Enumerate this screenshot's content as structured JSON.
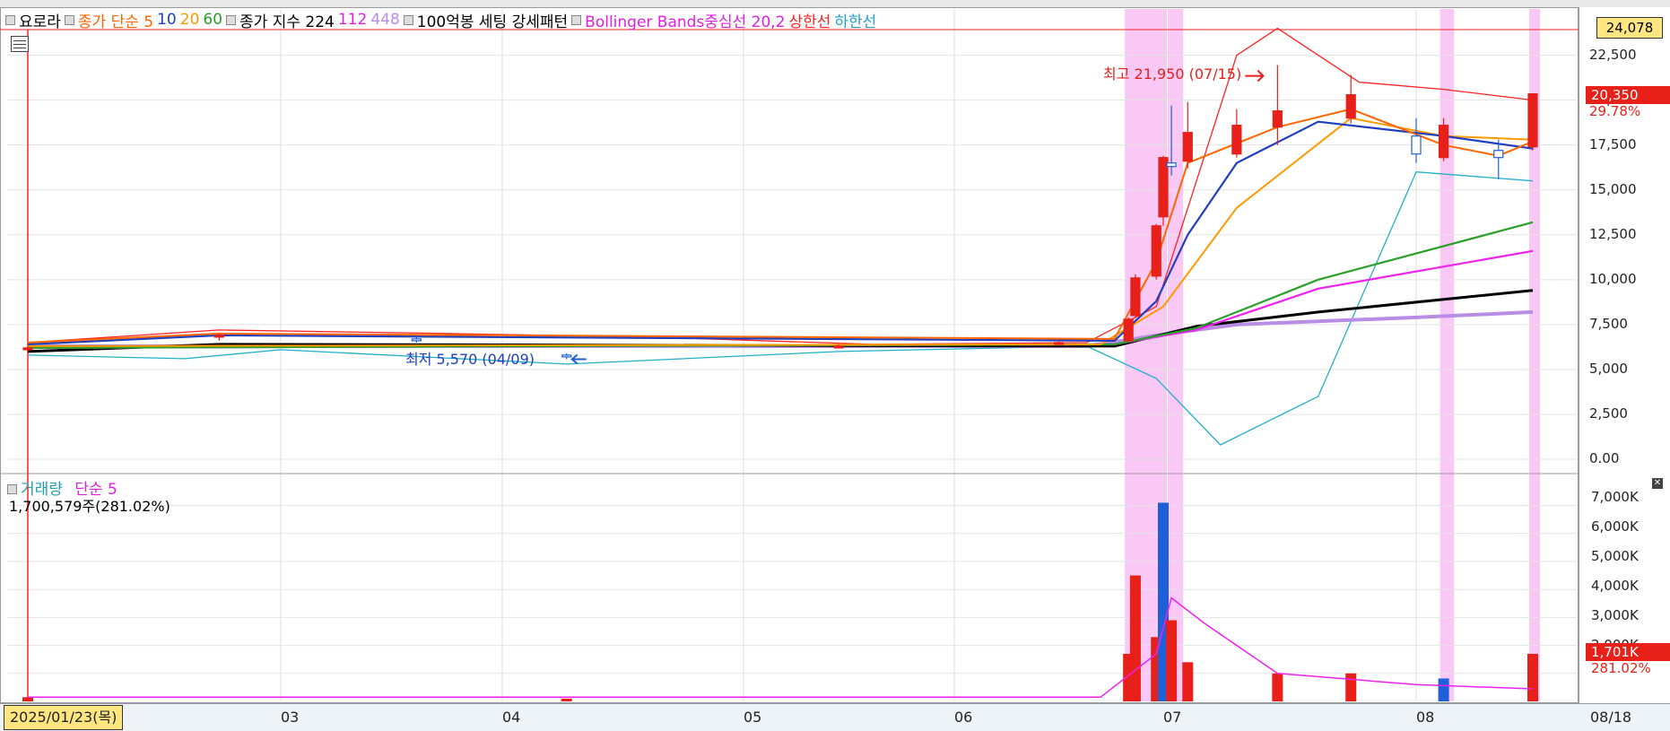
{
  "legend": {
    "items": [
      {
        "text": "요로라",
        "color": "#000000"
      },
      {
        "text": "종가 단순 5",
        "color": "#ff6600"
      },
      {
        "text": "10",
        "color": "#1f3fbf"
      },
      {
        "text": "20",
        "color": "#ff9900"
      },
      {
        "text": "60",
        "color": "#2aa02a"
      },
      {
        "text": "종가 지수 224",
        "color": "#000000"
      },
      {
        "text": "112",
        "color": "#dd22dd"
      },
      {
        "text": "448",
        "color": "#b98ce6"
      },
      {
        "text": "100억봉 세팅 강세패턴",
        "color": "#000000"
      },
      {
        "text": "Bollinger Bands중심선 20,2",
        "color": "#e020e0"
      },
      {
        "text": "상한선",
        "color": "#ff2222"
      },
      {
        "text": "하한선",
        "color": "#22a0d0"
      }
    ]
  },
  "annotations": {
    "high_label": "최고 21,950 (07/15)",
    "low_label": "최저 5,570 (04/09)",
    "volume_title": "거래량",
    "volume_ma": "단순 5",
    "volume_reading": "1,700,579주(281.02%)"
  },
  "price_axis": {
    "ticks": [
      "22,500",
      "20,000",
      "17,500",
      "15,000",
      "12,500",
      "10,000",
      "7,500",
      "5,000",
      "2,500",
      "0.00"
    ],
    "top_box": "24,078",
    "current_price": "20,350",
    "current_change": "29.78%"
  },
  "volume_axis": {
    "ticks": [
      "7,000K",
      "6,000K",
      "5,000K",
      "4,000K",
      "3,000K",
      "2,000K"
    ],
    "current_volume": "1,701K",
    "current_ratio": "281.02%"
  },
  "dates": {
    "current": "2025/01/23(목)",
    "months": [
      "03",
      "04",
      "05",
      "06",
      "07",
      "08",
      "08/18"
    ]
  },
  "colors": {
    "up": "#e8201a",
    "down": "#1f5fd8",
    "ma5": "#ff6600",
    "ma10": "#1f3fbf",
    "ma20": "#ff9900",
    "ma60": "#2aa02a",
    "ema224": "#000000",
    "ema112": "#ee22ee",
    "ema448": "#b98ce6",
    "bb_upper": "#ff2222",
    "bb_lower": "#22b0c8",
    "highlight": "#f7b6f0"
  },
  "chart_data": [
    {
      "type": "candlestick",
      "title": "요로라",
      "ylim": [
        0,
        24078
      ],
      "x_months": [
        "03",
        "04",
        "05",
        "06",
        "07",
        "08"
      ],
      "points": [
        {
          "date": "2025-01-23",
          "open": 6100,
          "high": 6300,
          "low": 6000,
          "close": 6200
        },
        {
          "date": "2025-02-20",
          "open": 6800,
          "high": 7000,
          "low": 6600,
          "close": 6900
        },
        {
          "date": "2025-03-20",
          "open": 6700,
          "high": 6900,
          "low": 6500,
          "close": 6600
        },
        {
          "date": "2025-04-09",
          "open": 5800,
          "high": 5900,
          "low": 5570,
          "close": 5700
        },
        {
          "date": "2025-05-15",
          "open": 6300,
          "high": 6400,
          "low": 6200,
          "close": 6300
        },
        {
          "date": "2025-06-16",
          "open": 6500,
          "high": 6600,
          "low": 6400,
          "close": 6500
        },
        {
          "date": "2025-06-26",
          "open": 6600,
          "high": 7900,
          "low": 6500,
          "close": 7800
        },
        {
          "date": "2025-06-27",
          "open": 8000,
          "high": 10300,
          "low": 7900,
          "close": 10100
        },
        {
          "date": "2025-06-30",
          "open": 10200,
          "high": 13100,
          "low": 10000,
          "close": 13000
        },
        {
          "date": "2025-07-01",
          "open": 13500,
          "high": 16900,
          "low": 13000,
          "close": 16800
        },
        {
          "date": "2025-07-02",
          "open": 16500,
          "high": 19700,
          "low": 15800,
          "close": 16300
        },
        {
          "date": "2025-07-04",
          "open": 16600,
          "high": 19900,
          "low": 16200,
          "close": 18200
        },
        {
          "date": "2025-07-10",
          "open": 17000,
          "high": 19500,
          "low": 16800,
          "close": 18600
        },
        {
          "date": "2025-07-15",
          "open": 18500,
          "high": 21950,
          "low": 17500,
          "close": 19400
        },
        {
          "date": "2025-07-24",
          "open": 19000,
          "high": 21400,
          "low": 18700,
          "close": 20300
        },
        {
          "date": "2025-08-01",
          "open": 18000,
          "high": 19000,
          "low": 16500,
          "close": 17000
        },
        {
          "date": "2025-08-05",
          "open": 16800,
          "high": 19000,
          "low": 16600,
          "close": 18600
        },
        {
          "date": "2025-08-13",
          "open": 17200,
          "high": 17800,
          "low": 15600,
          "close": 16800
        },
        {
          "date": "2025-08-18",
          "open": 17400,
          "high": 20350,
          "low": 17200,
          "close": 20350
        }
      ]
    },
    {
      "type": "bar",
      "title": "거래량",
      "ylabel": "거래량",
      "ylim": [
        0,
        7500000
      ],
      "categories": [
        "2025-01-23",
        "2025-04-09",
        "2025-06-26",
        "2025-06-27",
        "2025-06-30",
        "2025-07-01",
        "2025-07-02",
        "2025-07-04",
        "2025-07-15",
        "2025-07-24",
        "2025-08-05",
        "2025-08-18"
      ],
      "values": [
        150000,
        100000,
        1700000,
        4500000,
        2300000,
        7100000,
        2900000,
        1400000,
        1000000,
        1000000,
        820000,
        1700579
      ]
    }
  ]
}
